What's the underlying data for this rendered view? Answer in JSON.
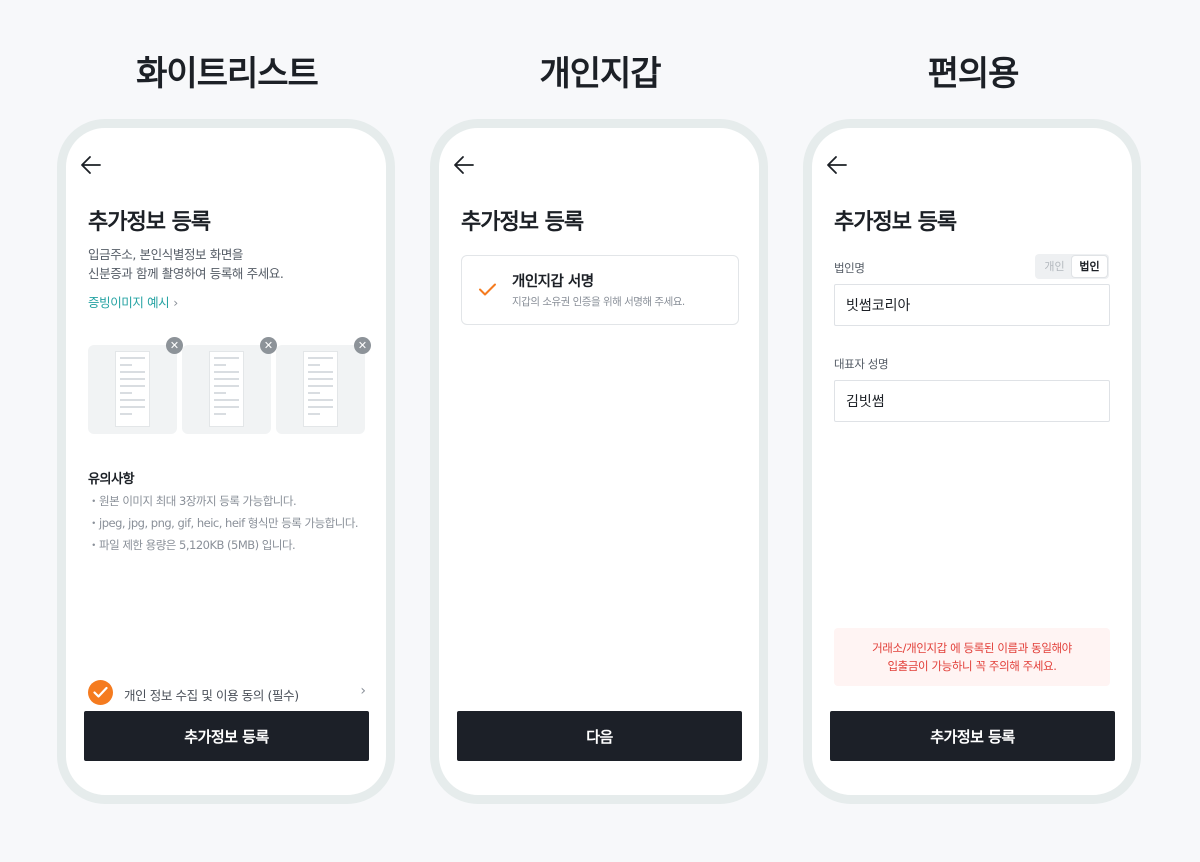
{
  "columns": [
    {
      "title": "화이트리스트",
      "heading": "추가정보 등록",
      "description_lines": [
        "입금주소, 본인식별정보 화면을",
        "신분증과 함께 촬영하여 등록해 주세요."
      ],
      "example_link": "증빙이미지 예시",
      "thumbnail_count": 3,
      "notice_title": "유의사항",
      "notices": [
        "・원본 이미지 최대 3장까지 등록 가능합니다.",
        "・jpeg, jpg, png, gif, heic, heif 형식만 등록 가능합니다.",
        "・파일 제한 용량은 5,120KB (5MB) 입니다."
      ],
      "consent_label": "개인 정보 수집 및 이용 동의 (필수)",
      "consent_checked": true,
      "button_label": "추가정보 등록"
    },
    {
      "title": "개인지갑",
      "heading": "추가정보 등록",
      "card_title": "개인지갑 서명",
      "card_subtitle": "지갑의 소유권 인증을 위해 서명해 주세요.",
      "card_checked": true,
      "button_label": "다음"
    },
    {
      "title": "편의용",
      "heading": "추가정보 등록",
      "field1_label": "법인명",
      "toggle_options": [
        "개인",
        "법인"
      ],
      "toggle_selected": "법인",
      "field1_value": "빗썸코리아",
      "field2_label": "대표자 성명",
      "field2_value": "김빗썸",
      "warning_lines": [
        "거래소/개인지갑 에 등록된 이름과 동일해야",
        "입출금이 가능하니 꼭 주의해 주세요."
      ],
      "button_label": "추가정보 등록"
    }
  ],
  "colors": {
    "accent_orange": "#f57b1f",
    "link_teal": "#26a3a3",
    "button_dark": "#1c2028",
    "warning_red": "#e2403a",
    "warning_bg": "#fff4f3",
    "phone_frame": "#e6ecec"
  },
  "icons": {
    "back": "arrow-left-icon",
    "chevron": "chevron-right-icon",
    "remove": "close-icon",
    "check": "check-icon"
  }
}
